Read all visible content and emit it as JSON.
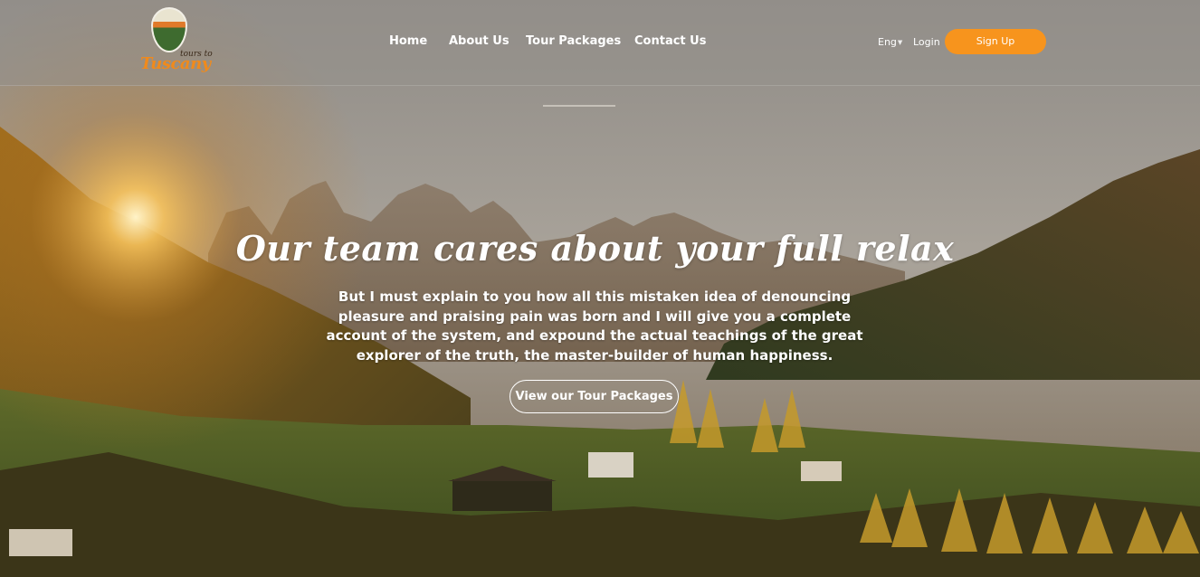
{
  "brand": {
    "logo_small": "tours to",
    "logo_big": "Tuscany"
  },
  "nav": {
    "items": [
      {
        "label": "Home"
      },
      {
        "label": "About Us"
      },
      {
        "label": "Tour Packages"
      },
      {
        "label": "Contact Us"
      }
    ],
    "language": "Eng",
    "login_label": "Login",
    "signup_label": "Sign Up"
  },
  "hero": {
    "headline": "Our team cares about your full relax",
    "body": "But I must explain to you how all this mistaken idea of denouncing pleasure and praising pain was born and I will give you a complete account of the system, and expound the actual teachings of the great explorer of the truth, the master-builder of human happiness.",
    "cta_label": "View our Tour Packages"
  },
  "colors": {
    "accent": "#f7941d",
    "text": "#ffffff"
  },
  "icons": {
    "language_dropdown": "chevron-down-icon"
  }
}
